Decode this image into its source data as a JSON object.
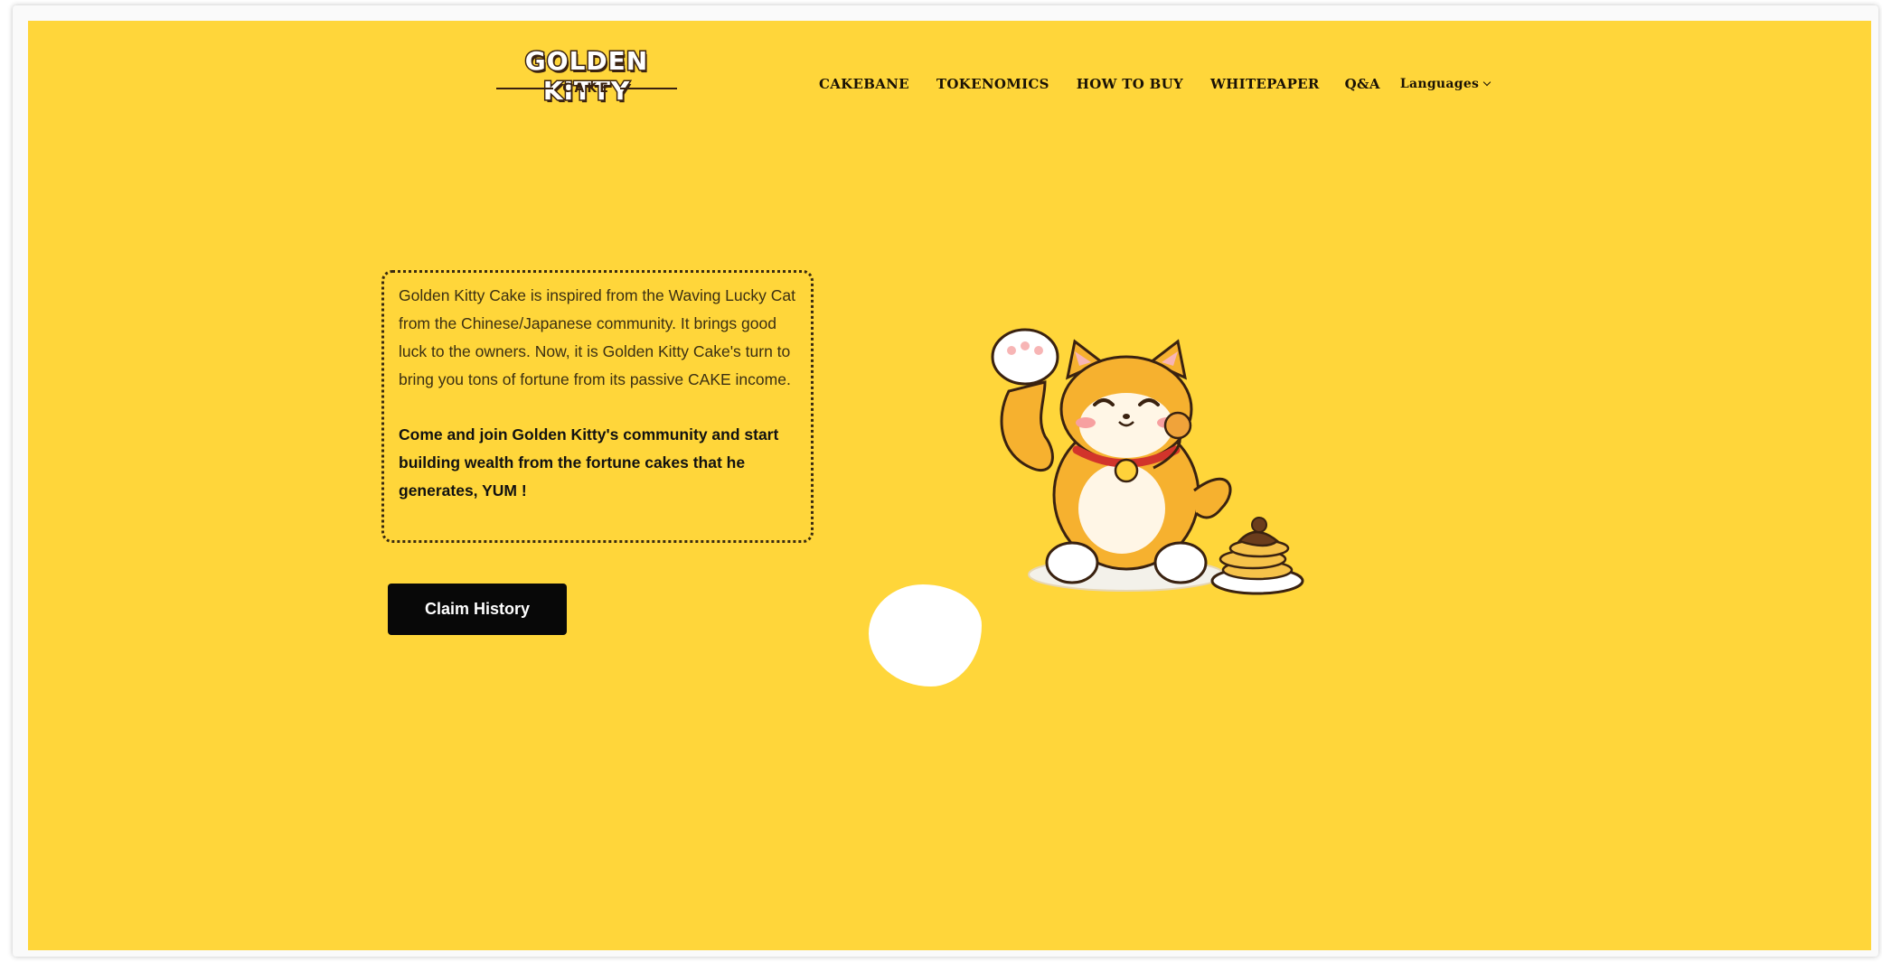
{
  "brand": {
    "logo_main": "GOLDEN KITTY",
    "logo_sub": "CAKE"
  },
  "nav": {
    "items": [
      {
        "label": "CAKEBANE"
      },
      {
        "label": "TOKENOMICS"
      },
      {
        "label": "HOW TO BUY"
      },
      {
        "label": "WHITEPAPER"
      },
      {
        "label": "Q&A"
      }
    ],
    "languages_label": "Languages"
  },
  "intro": {
    "description": "Golden Kitty Cake is inspired from the Waving Lucky Cat from the Chinese/Japanese community. It brings good luck to the owners. Now, it is Golden Kitty Cake's turn to bring you tons of fortune from its passive CAKE income.",
    "call_to_action": "Come and join Golden Kitty's community and start building wealth from the fortune cakes that he generates, YUM !"
  },
  "buttons": {
    "claim_history": "Claim History"
  },
  "colors": {
    "background": "#ffd63a",
    "button": "#080808",
    "text_dark": "#1a1206"
  },
  "icons": {
    "mascot": "lucky-cat-mascot",
    "cake": "pancake-stack"
  }
}
